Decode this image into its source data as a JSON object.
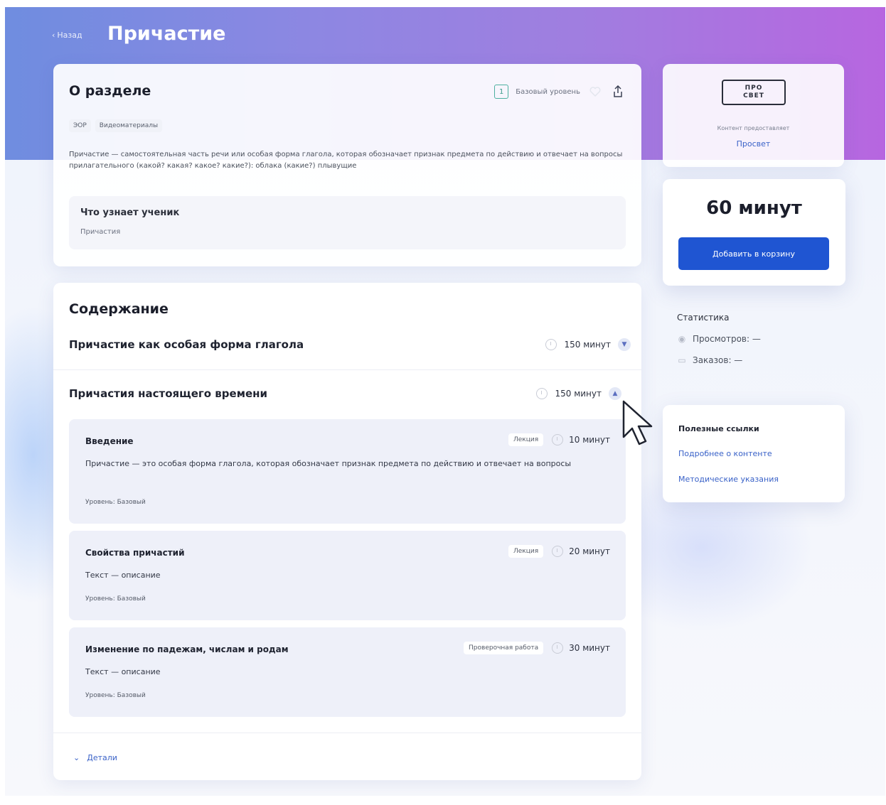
{
  "header": {
    "back_label": "Назад",
    "title": "Причастие"
  },
  "about": {
    "title": "О разделе",
    "level_number": "1",
    "level_label": "Базовый уровень",
    "tags": [
      "ЭОР",
      "Видеоматериалы"
    ],
    "description": "Причастие — самостоятельная часть речи или особая форма глагола, которая обозначает признак предмета по действию и отвечает на вопросы прилагательного (какой? какая? какое? какие?): облака (какие?) плывущие",
    "learn_title": "Что узнает ученик",
    "learn_item": "Причастия"
  },
  "content": {
    "title": "Содержание",
    "sections": [
      {
        "name": "Причастие как особая форма глагола",
        "duration": "150 минут"
      },
      {
        "name": "Причастия настоящего времени",
        "duration": "150 минут"
      }
    ],
    "lessons": [
      {
        "name": "Введение",
        "type": "Лекция",
        "duration": "10 минут",
        "description": "Причастие — это особая форма глагола, которая обозначает признак предмета по действию и отвечает на вопросы",
        "level": "Уровень: Базовый"
      },
      {
        "name": "Свойства причастий",
        "type": "Лекция",
        "duration": "20 минут",
        "description": "Текст — описание",
        "level": "Уровень: Базовый"
      },
      {
        "name": "Изменение по падежам, числам и родам",
        "type": "Проверочная работа",
        "duration": "30 минут",
        "description": "Текст — описание",
        "level": "Уровень: Базовый"
      }
    ],
    "details_label": "Детали"
  },
  "provider": {
    "logo_line1": "ПРО",
    "logo_line2": "СВЕТ",
    "caption": "Контент предоставляет",
    "name": "Просвет"
  },
  "price": {
    "value": "60 минут",
    "cart_button": "Добавить в корзину"
  },
  "stats": {
    "title": "Статистика",
    "views": "Просмотров: —",
    "orders": "Заказов: —"
  },
  "links": {
    "title": "Полезные ссылки",
    "items": [
      "Подробнее о контенте",
      "Методические указания"
    ]
  },
  "colors": {
    "accent": "#1f55d2",
    "link": "#3a62c8",
    "hero_start": "#6f8de0",
    "hero_end": "#b766e0"
  }
}
